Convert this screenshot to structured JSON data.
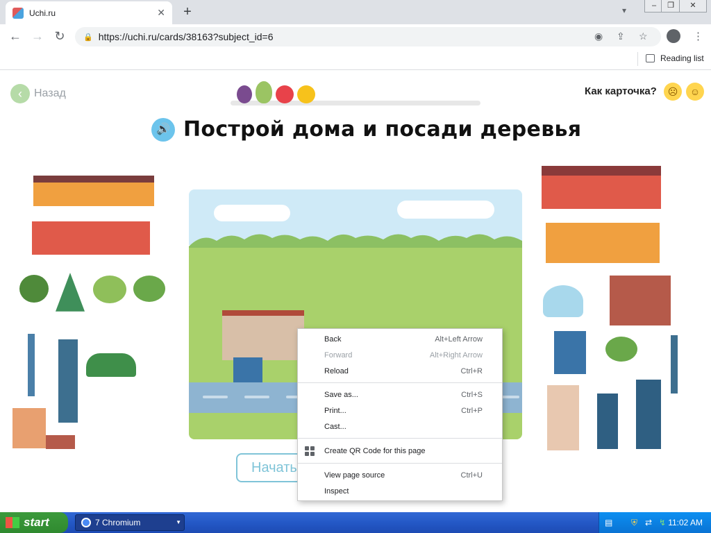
{
  "browser": {
    "tab_title": "Uchi.ru",
    "tab_close": "✕",
    "new_tab": "+",
    "url": "https://uchi.ru/cards/38163?subject_id=6",
    "reading_list": "Reading list"
  },
  "page": {
    "back_label": "Назад",
    "rate_label": "Как карточка?",
    "title": "Построй дома и посади деревья",
    "start_button": "Начать"
  },
  "context_menu": {
    "items": [
      {
        "label": "Back",
        "shortcut": "Alt+Left Arrow",
        "disabled": false
      },
      {
        "label": "Forward",
        "shortcut": "Alt+Right Arrow",
        "disabled": true
      },
      {
        "label": "Reload",
        "shortcut": "Ctrl+R",
        "disabled": false
      },
      {
        "label": "Save as...",
        "shortcut": "Ctrl+S",
        "disabled": false
      },
      {
        "label": "Print...",
        "shortcut": "Ctrl+P",
        "disabled": false
      },
      {
        "label": "Cast...",
        "shortcut": "",
        "disabled": false
      },
      {
        "label": "Create QR Code for this page",
        "shortcut": "",
        "disabled": false
      },
      {
        "label": "View page source",
        "shortcut": "Ctrl+U",
        "disabled": false
      },
      {
        "label": "Inspect",
        "shortcut": "",
        "disabled": false
      }
    ]
  },
  "taskbar": {
    "start_label": "start",
    "task_label": "7 Chromium",
    "clock": "11:02 AM"
  },
  "colors": {
    "back_green": "#b6dba8",
    "speaker_blue": "#6cc4ec",
    "grass": "#a9d16b",
    "road": "#8eb4d1",
    "start_border": "#7fc4d8"
  }
}
